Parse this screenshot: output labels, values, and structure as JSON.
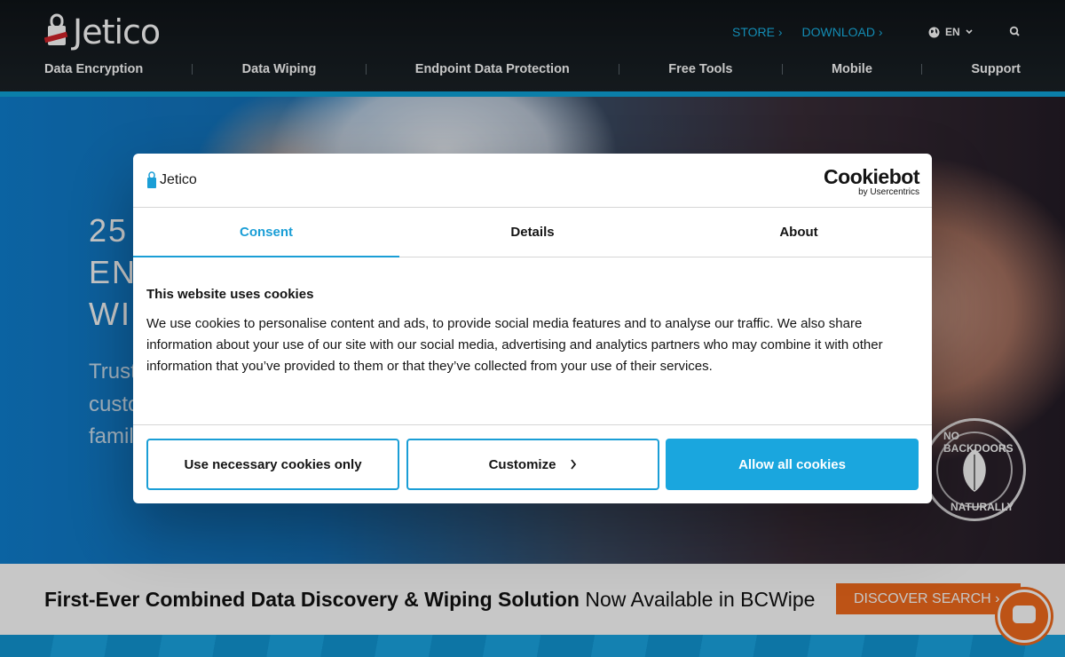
{
  "header": {
    "logo_text": "Jetico",
    "top_links": [
      "STORE ›",
      "DOWNLOAD ›"
    ],
    "language": "EN",
    "nav": [
      "Data Encryption",
      "Data Wiping",
      "Endpoint Data Protection",
      "Free Tools",
      "Mobile",
      "Support"
    ]
  },
  "hero": {
    "title_lines": [
      "25",
      "ENC",
      "WI"
    ],
    "sub_lines": [
      "Trust",
      "custo",
      "famil"
    ],
    "badge_top": "NO BACKDOORS",
    "badge_bottom": "NATURALLY"
  },
  "promo": {
    "bold_text": "First-Ever Combined Data Discovery & Wiping Solution",
    "rest_text": "Now Available in BCWipe",
    "button_label": "DISCOVER SEARCH ›"
  },
  "dialog": {
    "logo_text": "Jetico",
    "brand_main": "Cookiebot",
    "brand_sub": "by Usercentrics",
    "tabs": [
      "Consent",
      "Details",
      "About"
    ],
    "heading": "This website uses cookies",
    "body": "We use cookies to personalise content and ads, to provide social media features and to analyse our traffic. We also share information about your use of our site with our social media, advertising and analytics partners who may combine it with other information that you’ve provided to them or that they’ve collected from your use of their services.",
    "buttons": {
      "necessary": "Use necessary cookies only",
      "customize": "Customize",
      "allow_all": "Allow all cookies"
    }
  },
  "colors": {
    "accent": "#1a9ed6",
    "header_bg": "#141a1e",
    "promo_button": "#f26b1d"
  }
}
